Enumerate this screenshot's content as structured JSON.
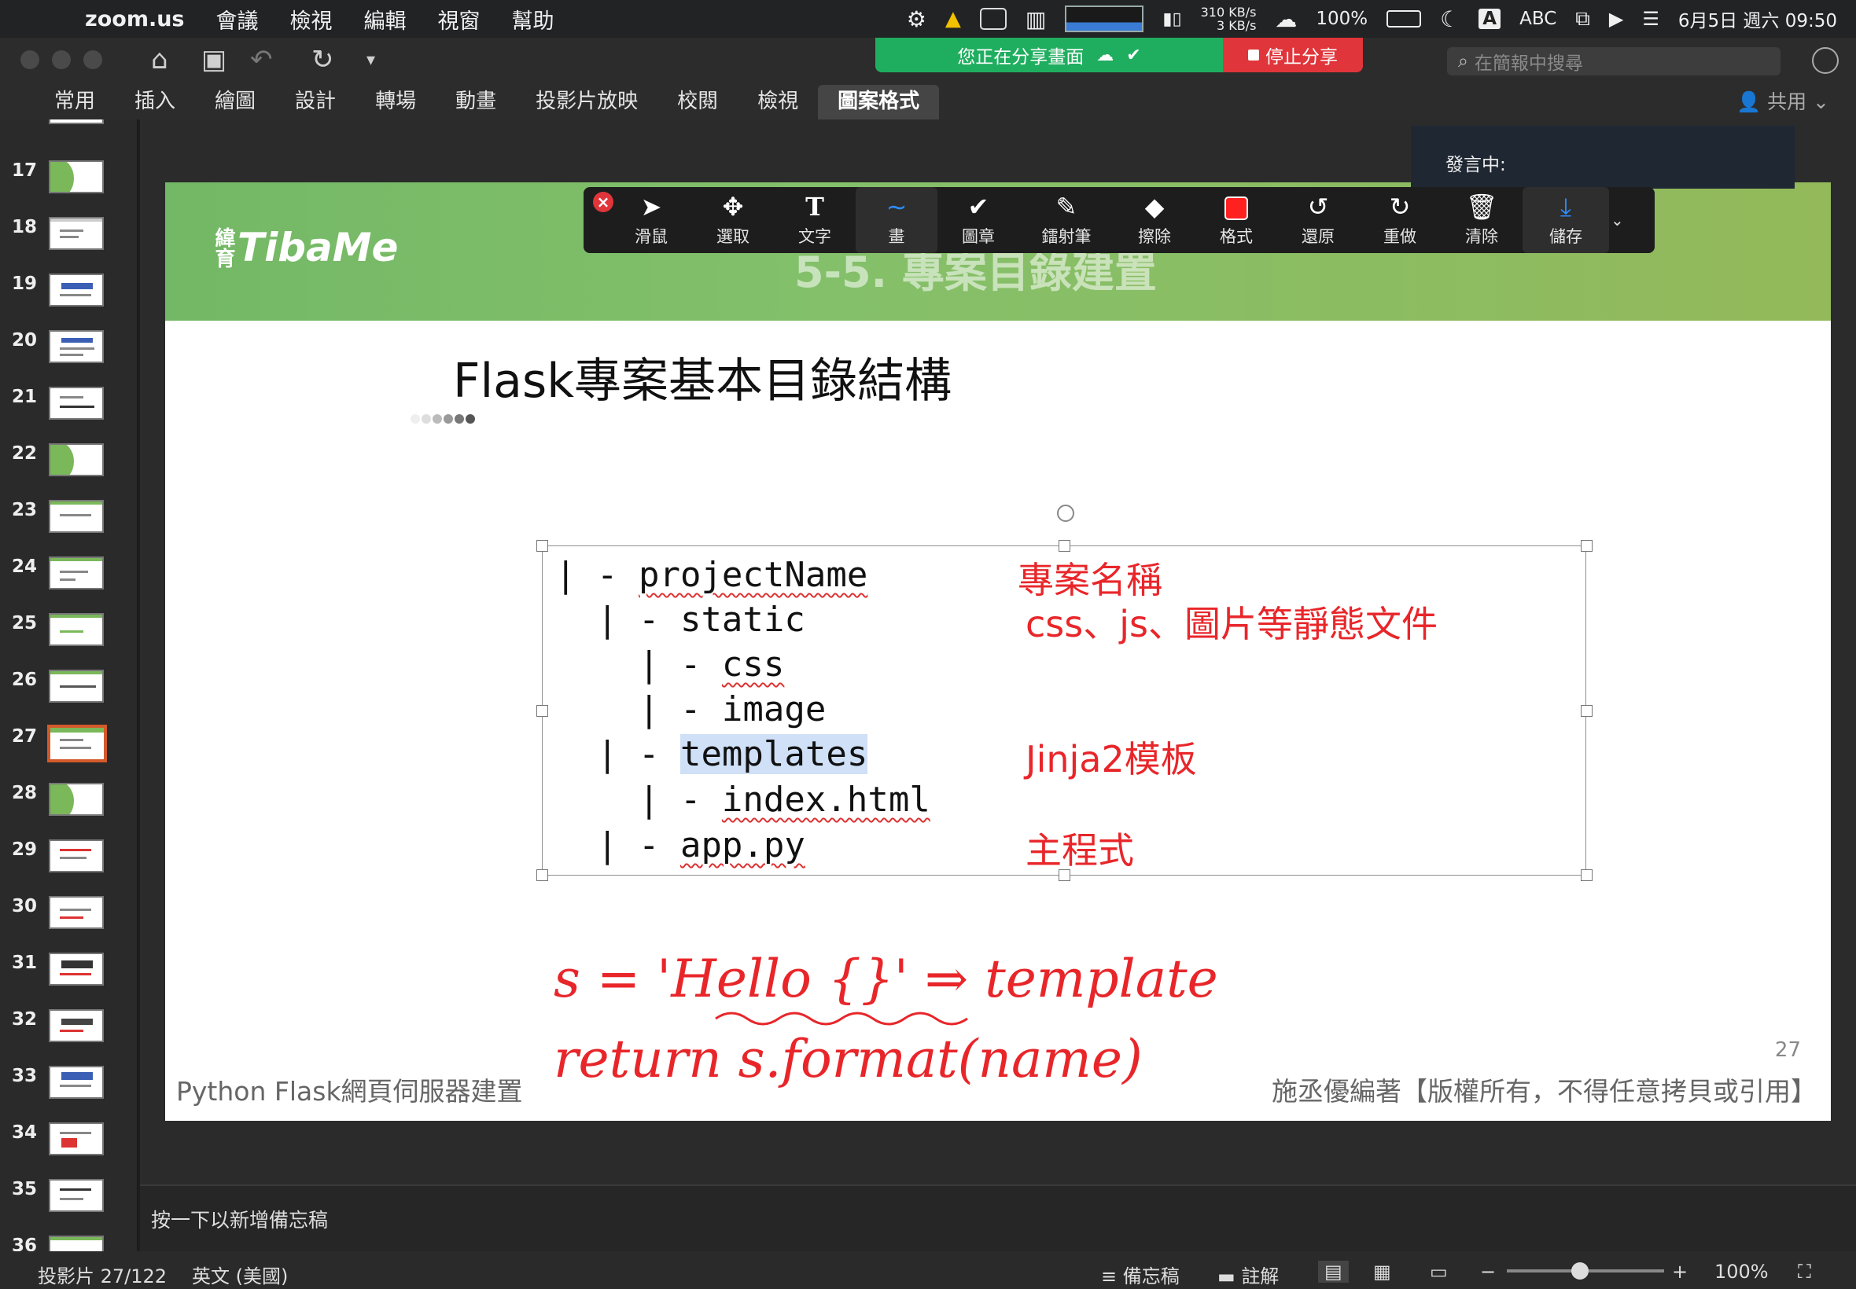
{
  "menubar": {
    "app": "zoom.us",
    "menus": [
      "會議",
      "檢視",
      "編輯",
      "視窗",
      "幫助"
    ],
    "net_up": "310 KB/s",
    "net_down": "3 KB/s",
    "battery": "100%",
    "input_source": "ABC",
    "datetime": "6月5日 週六 09:50"
  },
  "zoom_share": {
    "status": "您正在分享畫面",
    "stop_label": "停止分享",
    "speaking_label": "發言中:"
  },
  "search": {
    "placeholder": "在簡報中搜尋"
  },
  "ribbon": {
    "tabs": [
      "常用",
      "插入",
      "繪圖",
      "設計",
      "轉場",
      "動畫",
      "投影片放映",
      "校閱",
      "檢視",
      "圖案格式"
    ],
    "active_tab": "圖案格式",
    "share_label": "共用"
  },
  "annotation_toolbar": {
    "tools": [
      {
        "label": "滑鼠",
        "icon": "mouse-cursor-icon"
      },
      {
        "label": "選取",
        "icon": "move-icon"
      },
      {
        "label": "文字",
        "icon": "text-icon"
      },
      {
        "label": "畫",
        "icon": "draw-icon"
      },
      {
        "label": "圖章",
        "icon": "stamp-check-icon"
      },
      {
        "label": "鐳射筆",
        "icon": "laser-pen-icon"
      },
      {
        "label": "擦除",
        "icon": "eraser-icon"
      },
      {
        "label": "格式",
        "icon": "color-format-icon"
      },
      {
        "label": "還原",
        "icon": "undo-icon"
      },
      {
        "label": "重做",
        "icon": "redo-icon"
      },
      {
        "label": "清除",
        "icon": "trash-icon"
      },
      {
        "label": "儲存",
        "icon": "save-download-icon"
      }
    ],
    "active_tool": "畫",
    "pen_color": "#ff2020"
  },
  "thumbnails": {
    "numbers": [
      "17",
      "18",
      "19",
      "20",
      "21",
      "22",
      "23",
      "24",
      "25",
      "26",
      "27",
      "28",
      "29",
      "30",
      "31",
      "32",
      "33",
      "34",
      "35",
      "36"
    ],
    "selected": "27"
  },
  "slide": {
    "header_title": "5-5. 專案目錄建置",
    "logo_small": "緯育",
    "logo_text": "TibaMe",
    "title": "Flask專案基本目錄結構",
    "code_lines": [
      {
        "prefix": "| - ",
        "name": "projectName",
        "note": "專案名稱"
      },
      {
        "prefix": "  | - ",
        "name": "static",
        "note": "css、js、圖片等靜態文件"
      },
      {
        "prefix": "    | - ",
        "name": "css",
        "note": ""
      },
      {
        "prefix": "    | - ",
        "name": "image",
        "note": ""
      },
      {
        "prefix": "  | - ",
        "name": "templates",
        "note": "Jinja2模板"
      },
      {
        "prefix": "    | - ",
        "name": "index.html",
        "note": ""
      },
      {
        "prefix": "  | - ",
        "name": "app.py",
        "note": "主程式"
      }
    ],
    "handwriting_line1": "s = 'Hello {}'  ⇒ template",
    "handwriting_line2": "return  s.format(name)",
    "page_number": "27",
    "footer_left": "Python Flask網頁伺服器建置",
    "footer_right": "施丞優編著【版權所有，不得任意拷貝或引用】"
  },
  "notes": {
    "placeholder": "按一下以新增備忘稿"
  },
  "statusbar": {
    "slide_info": "投影片 27/122",
    "language": "英文 (美國)",
    "notes_btn": "備忘稿",
    "comments_btn": "註解",
    "zoom": "100%"
  },
  "colors": {
    "accent_red": "#e8262a",
    "header_green": "#84c06a",
    "selected_thumb": "#d25a2b",
    "zoom_green": "#1fae5f"
  }
}
